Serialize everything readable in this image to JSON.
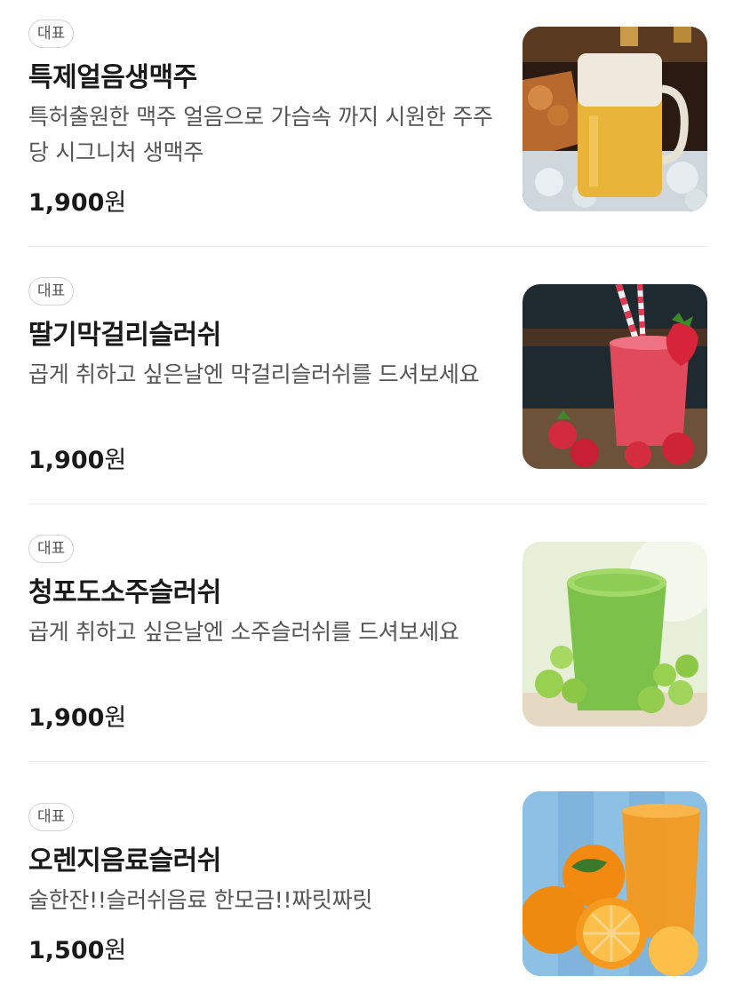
{
  "menu": {
    "items": [
      {
        "badge": "대표",
        "name": "특제얼음생맥주",
        "description": "특허출원한 맥주 얼음으로 가슴속 까지 시원한 주주당 시그니처 생맥주",
        "price": "1,900",
        "currency": "원",
        "image": "beer-mug-image"
      },
      {
        "badge": "대표",
        "name": "딸기막걸리슬러쉬",
        "description": "곱게 취하고 싶은날엔 막걸리슬러쉬를 드셔보세요",
        "price": "1,900",
        "currency": "원",
        "image": "strawberry-slush-image"
      },
      {
        "badge": "대표",
        "name": "청포도소주슬러쉬",
        "description": "곱게 취하고 싶은날엔 소주슬러쉬를 드셔보세요",
        "price": "1,900",
        "currency": "원",
        "image": "green-grape-slush-image"
      },
      {
        "badge": "대표",
        "name": "오렌지음료슬러쉬",
        "description": "술한잔!!슬러쉬음료 한모금!!짜릿짜릿",
        "price": "1,500",
        "currency": "원",
        "image": "orange-juice-image"
      }
    ]
  }
}
